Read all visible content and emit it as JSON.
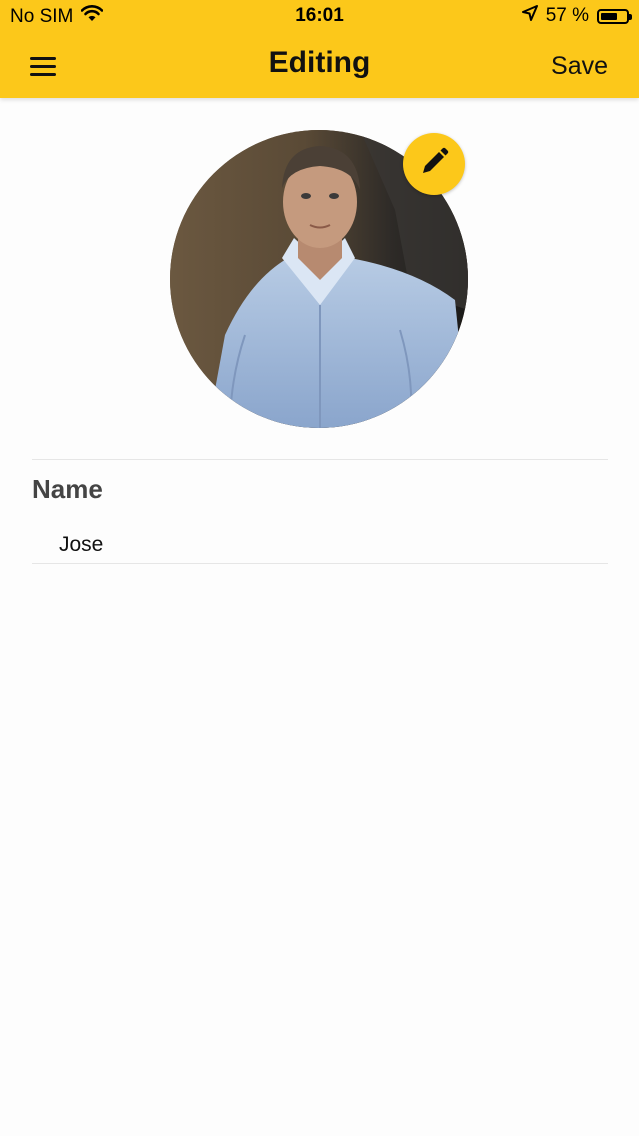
{
  "status_bar": {
    "carrier": "No SIM",
    "time": "16:01",
    "battery": "57 %",
    "battery_level": 0.57,
    "icons": [
      "wifi-icon",
      "location-arrow-icon",
      "battery-icon"
    ]
  },
  "nav": {
    "title": "Editing",
    "save_label": "Save",
    "menu_icon": "hamburger-menu-icon"
  },
  "profile": {
    "edit_icon": "pencil-icon"
  },
  "form": {
    "name_label": "Name",
    "name_value": "Jose"
  },
  "colors": {
    "accent": "#fcc81a",
    "background": "#fdfdfd",
    "text": "#111111",
    "label": "#444444"
  }
}
